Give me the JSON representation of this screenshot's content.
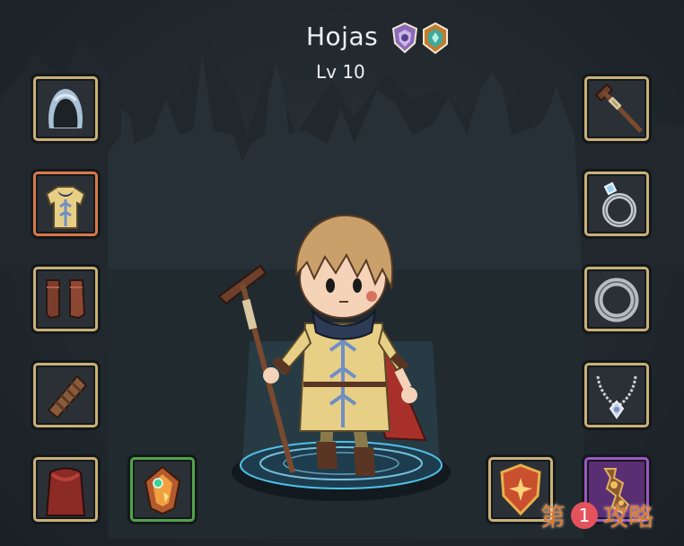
{
  "hero": {
    "name": "Hojas",
    "level": "Lv 10",
    "badges": [
      "purple-shield-emblem",
      "teal-gem-emblem"
    ]
  },
  "equipment": {
    "left": [
      "hood",
      "tunic",
      "boots",
      "bracer",
      "cape",
      "amulet-gem"
    ],
    "right": [
      "staff",
      "sapphire-ring",
      "silver-ring",
      "pendant-necklace",
      "star-shield",
      "relic-ornament"
    ]
  },
  "colors": {
    "slot_border": "#c9b078",
    "slot_border_selected": "#d9784a",
    "slot_border_green": "#52a24c",
    "slot_border_purple": "#9a58c2",
    "pedestal_glow": "#4fc0e8"
  },
  "watermark": {
    "pre": "第",
    "num": "1",
    "post": "攻略"
  }
}
